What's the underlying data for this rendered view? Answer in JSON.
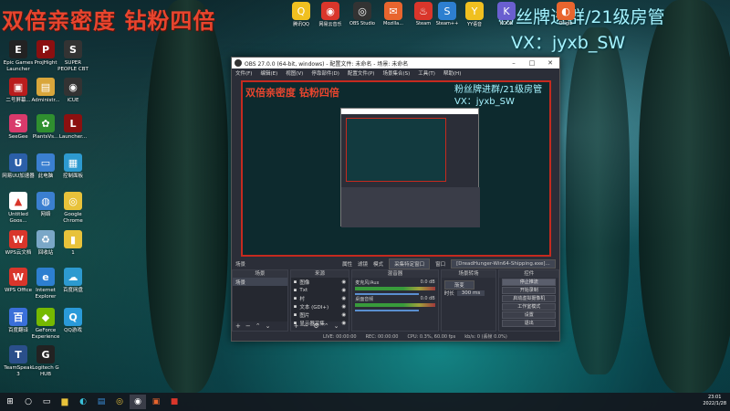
{
  "overlay": {
    "top_left": "双倍亲密度 钻粉四倍",
    "top_right": "粉丝牌进群/21级房管",
    "vx": "VX：jyxb_SW"
  },
  "desktop_icons": [
    {
      "label": "Epic Games Launcher",
      "color": "#222",
      "glyph": "E"
    },
    {
      "label": "ProjHight",
      "color": "#8b0f10",
      "glyph": "P"
    },
    {
      "label": "SUPER PEOPLE CBT",
      "color": "#333",
      "glyph": "S"
    },
    {
      "label": "二号屏幕...",
      "color": "#b91d1d",
      "glyph": "▣"
    },
    {
      "label": "Administr...",
      "color": "#d9a63b",
      "glyph": "▤"
    },
    {
      "label": "iCUE",
      "color": "#333",
      "glyph": "◉"
    },
    {
      "label": "SeeGee",
      "color": "#d93a6b",
      "glyph": "S"
    },
    {
      "label": "PlantsVs...",
      "color": "#2f8f2f",
      "glyph": "✿"
    },
    {
      "label": "Launcher...",
      "color": "#8b1010",
      "glyph": "L"
    },
    {
      "label": "网易UU加速器",
      "color": "#2b5fa8",
      "glyph": "U"
    },
    {
      "label": "此电脑",
      "color": "#3a7fd0",
      "glyph": "▭"
    },
    {
      "label": "控制面板",
      "color": "#2d9ad0",
      "glyph": "▦"
    },
    {
      "label": "Untitled Goos...",
      "color": "#fff",
      "glyph": "▲"
    },
    {
      "label": "网络",
      "color": "#3a7fd0",
      "glyph": "◍"
    },
    {
      "label": "Google Chrome",
      "color": "#e8c23a",
      "glyph": "◎"
    },
    {
      "label": "WPS云文档",
      "color": "#d9362b",
      "glyph": "W"
    },
    {
      "label": "回收站",
      "color": "#7aa7c7",
      "glyph": "♻"
    },
    {
      "label": "1",
      "color": "#e8c23a",
      "glyph": "▮"
    },
    {
      "label": "WPS Office",
      "color": "#d9362b",
      "glyph": "W"
    },
    {
      "label": "Internet Explorer",
      "color": "#2d7fd0",
      "glyph": "e"
    },
    {
      "label": "百度网盘",
      "color": "#2d9ad0",
      "glyph": "☁"
    },
    {
      "label": "百度翻译",
      "color": "#3a6fd9",
      "glyph": "百"
    },
    {
      "label": "GeForce Experience",
      "color": "#76b900",
      "glyph": "◆"
    },
    {
      "label": "QQ游戏",
      "color": "#2a9ad9",
      "glyph": "Q"
    },
    {
      "label": "TeamSpeak 3",
      "color": "#2a4f8a",
      "glyph": "T"
    },
    {
      "label": "Logitech G HUB",
      "color": "#222",
      "glyph": "G"
    }
  ],
  "top_icons": [
    {
      "label": "腾讯QQ",
      "color": "#f0c020",
      "glyph": "Q"
    },
    {
      "label": "网易云音乐",
      "color": "#d9362b",
      "glyph": "◉"
    },
    {
      "label": "OBS Studio",
      "color": "#333",
      "glyph": "◎"
    },
    {
      "label": "Mozilla...",
      "color": "#e8652e",
      "glyph": "✉"
    },
    {
      "label": "Steam",
      "color": "#d9362b",
      "glyph": "♨"
    },
    {
      "label": "Steam++",
      "color": "#2d7fd0",
      "glyph": "S"
    },
    {
      "label": "YY语音",
      "color": "#f0c020",
      "glyph": "Y"
    },
    {
      "label": "KOOK",
      "color": "#6a5fd0",
      "glyph": "K"
    },
    {
      "label": "Origin",
      "color": "#e8652e",
      "glyph": "◐"
    }
  ],
  "obs": {
    "title": "OBS 27.0.0 (64-bit, windows) - 配置文件: 未命名 - 场景: 未命名",
    "menu": [
      "文件(F)",
      "编辑(E)",
      "视图(V)",
      "停靠部件(D)",
      "配置文件(P)",
      "场景集合(S)",
      "工具(T)",
      "帮助(H)"
    ],
    "preview_red": "双倍亲密度 钻粉四倍",
    "preview_cyan1": "粉丝牌进群/21级房管",
    "preview_cyan2": "VX：jyxb_SW",
    "toolbar": {
      "scene_label": "场景",
      "props": "属性",
      "filters": "滤镜",
      "mode": "模式",
      "mode_value": "采集特定窗口",
      "window": "窗口",
      "window_value": "[DreadHunger-Win64-Shipping.exe]..."
    },
    "docks": {
      "scenes": "场景",
      "sources": "来源",
      "mixer": "混音器",
      "transitions": "场景转场",
      "controls": "控件"
    },
    "scene_item": "场景",
    "sources": [
      "图像",
      "Txt",
      "村",
      "文本 (GDI+)",
      "图片",
      "显示器采集"
    ],
    "mixer": [
      {
        "name": "麦克风/Aux",
        "db": "0.0 dB"
      },
      {
        "name": "桌面音频",
        "db": "0.0 dB"
      }
    ],
    "transition": {
      "value": "渐变",
      "duration_label": "时长",
      "duration": "300 ms"
    },
    "controls": [
      "停止推流",
      "开始录制",
      "启动虚拟摄像机",
      "工作室模式",
      "设置",
      "退出"
    ],
    "status": {
      "live": "LIVE: 00:00:00",
      "rec": "REC: 00:00:00",
      "cpu": "CPU: 0.3%, 60.00 fps",
      "kbps": "kb/s: 0 (丢帧 0.0%)"
    }
  },
  "taskbar": {
    "time": "23:01",
    "date": "2022/1/28"
  }
}
